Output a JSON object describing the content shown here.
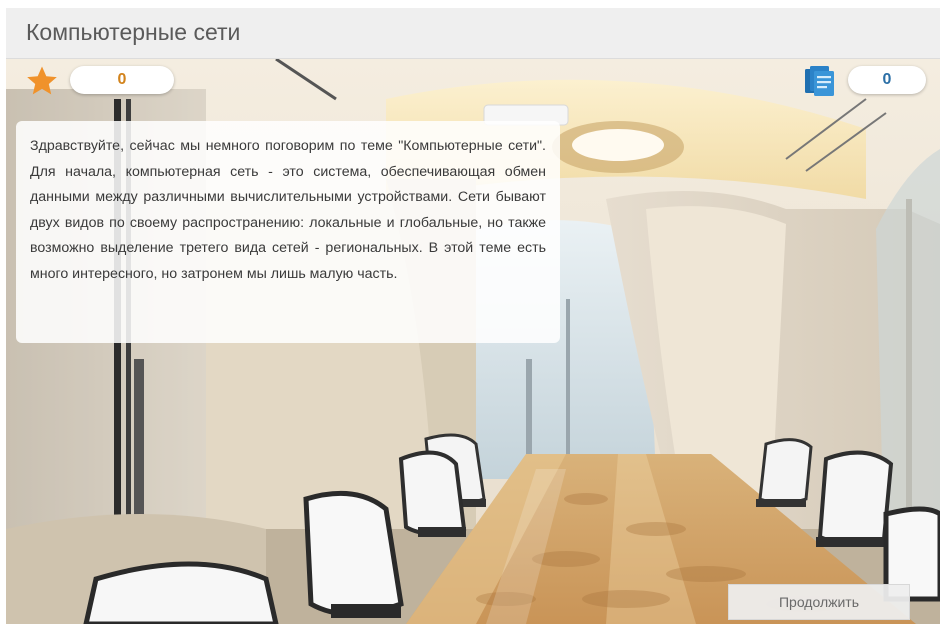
{
  "window": {
    "title": "Компьютерные сети"
  },
  "hud": {
    "score_icon": "star-icon",
    "score_value": "0",
    "score_color": "#f0922b",
    "docs_icon": "documents-icon",
    "docs_value": "0",
    "docs_color": "#2b7fc0"
  },
  "dialog": {
    "text": "Здравствуйте, сейчас мы немного поговорим по теме \"Компьютерные сети\". Для начала, компьютерная сеть - это система, обеспечивающая обмен данными между различными вычислительными устройствами. Сети бывают двух видов по своему распространению: локальные и глобальные, но также возможно выделение третего вида сетей - региональных. В этой теме есть много интересного, но затронем мы лишь малую часть."
  },
  "actions": {
    "continue_label": "Продолжить"
  },
  "scene": {
    "background": "conference-room"
  }
}
